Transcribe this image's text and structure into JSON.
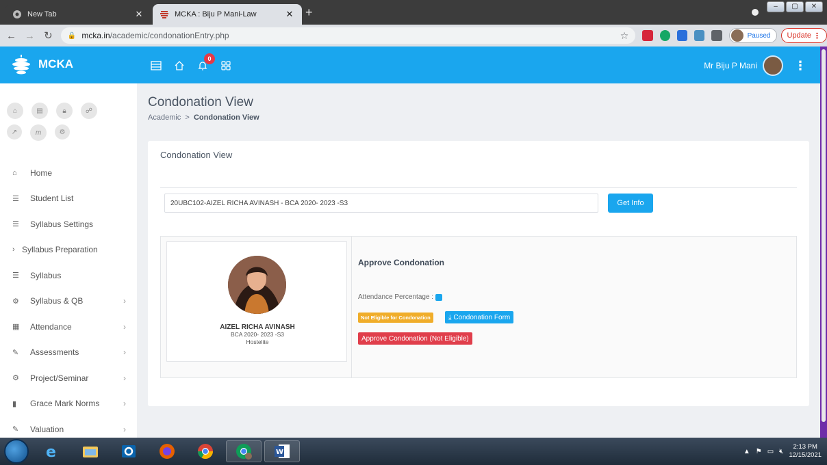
{
  "browser": {
    "tabs": [
      {
        "title": "New Tab",
        "active": false
      },
      {
        "title": "MCKA : Biju P Mani-Law",
        "active": true
      }
    ],
    "url_host": "mcka.in",
    "url_path": "/academic/condonationEntry.php",
    "profile_label": "Paused",
    "update_label": "Update"
  },
  "header": {
    "app_name": "MCKA",
    "notification_count": "0",
    "user_name": "Mr Biju P Mani"
  },
  "sidebar": {
    "items": [
      {
        "label": "Home",
        "icon": "home-icon",
        "chevron": false
      },
      {
        "label": "Student List",
        "icon": "list-icon",
        "chevron": false
      },
      {
        "label": "Syllabus Settings",
        "icon": "list-icon",
        "chevron": false
      },
      {
        "label": "Syllabus Preparation",
        "icon": "chevron-right-icon",
        "chevron": false
      },
      {
        "label": "Syllabus",
        "icon": "list-icon",
        "chevron": false
      },
      {
        "label": "Syllabus & QB",
        "icon": "cogs-icon",
        "chevron": true
      },
      {
        "label": "Attendance",
        "icon": "calendar-icon",
        "chevron": true
      },
      {
        "label": "Assessments",
        "icon": "pencil-icon",
        "chevron": true
      },
      {
        "label": "Project/Seminar",
        "icon": "cogs-icon",
        "chevron": true
      },
      {
        "label": "Grace Mark Norms",
        "icon": "book-icon",
        "chevron": true
      },
      {
        "label": "Valuation",
        "icon": "pencil-icon",
        "chevron": true
      }
    ]
  },
  "page": {
    "title": "Condonation View",
    "breadcrumb_parent": "Academic",
    "breadcrumb_sep": ">",
    "breadcrumb_current": "Condonation View"
  },
  "card": {
    "title": "Condonation View",
    "selected_student": "20UBC102-AIZEL RICHA AVINASH - BCA 2020- 2023 -S3",
    "get_info_label": "Get Info"
  },
  "student": {
    "name": "AIZEL RICHA AVINASH",
    "course": "BCA 2020- 2023 -S3",
    "residence": "Hostelite"
  },
  "condonation": {
    "heading": "Approve Condonation",
    "attendance_label": "Attendance Percentage :",
    "eligibility_badge": "Not Eligible for Condonation",
    "form_button": "Condonation Form",
    "approve_button": "Approve Condonation (Not Eligible)"
  },
  "taskbar": {
    "time": "2:13 PM",
    "date": "12/15/2021"
  },
  "colors": {
    "primary": "#1aa6ee",
    "danger": "#e03e4b",
    "warning": "#f0ad2a"
  }
}
